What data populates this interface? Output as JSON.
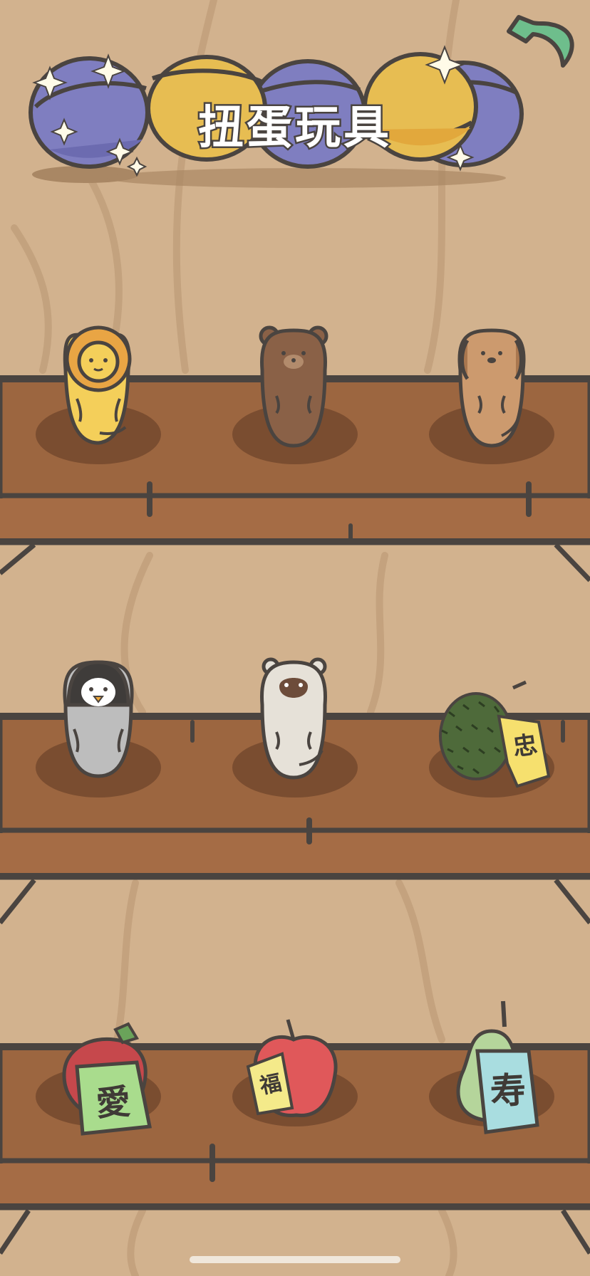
{
  "header": {
    "title": "扭蛋玩具",
    "capsule_colors": [
      "#7f7ec0",
      "#e7bd52",
      "#7f7ec0",
      "#e7bd52",
      "#7f7ec0"
    ],
    "back_icon": "back-arrow-icon",
    "back_color": "#6ebe8c"
  },
  "shelves": [
    {
      "items": [
        {
          "name": "lion",
          "icon": "lion-doll-icon"
        },
        {
          "name": "bear",
          "icon": "bear-doll-icon"
        },
        {
          "name": "dog",
          "icon": "dog-doll-icon"
        }
      ]
    },
    {
      "items": [
        {
          "name": "penguin",
          "icon": "penguin-doll-icon"
        },
        {
          "name": "monkey",
          "icon": "monkey-doll-icon"
        },
        {
          "name": "durian",
          "icon": "durian-icon",
          "tag": "忠"
        }
      ]
    },
    {
      "items": [
        {
          "name": "strawberry",
          "icon": "strawberry-icon",
          "tag": "愛"
        },
        {
          "name": "apple",
          "icon": "apple-icon",
          "tag": "福"
        },
        {
          "name": "pear",
          "icon": "pear-icon",
          "tag": "寿"
        }
      ]
    }
  ],
  "colors": {
    "wall": "#d2b28e",
    "shelf": "#9c6640",
    "outline": "#4a4440"
  }
}
